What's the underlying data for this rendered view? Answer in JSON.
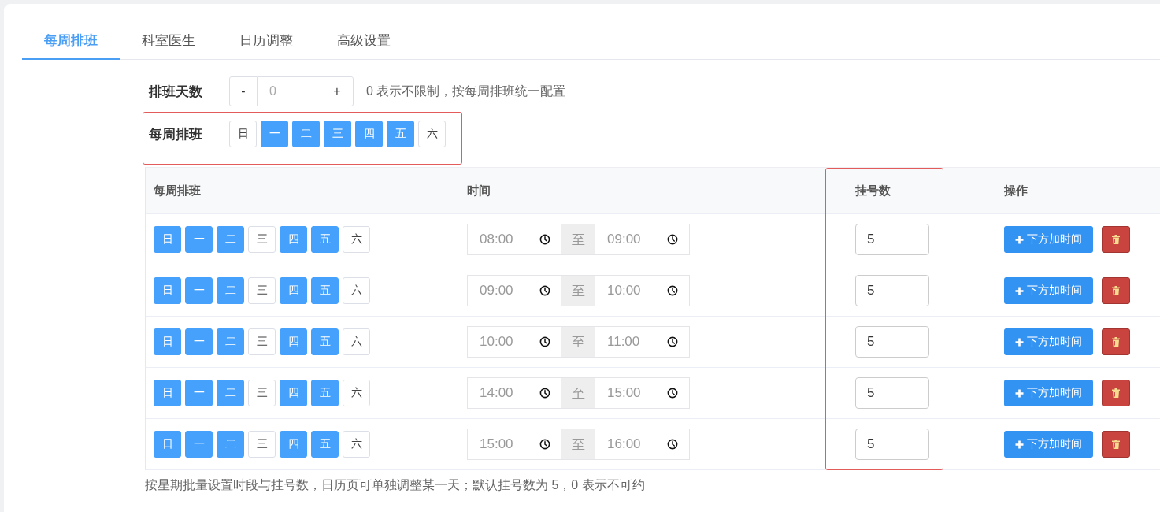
{
  "tabs": [
    {
      "label": "每周排班",
      "selected": true
    },
    {
      "label": "科室医生",
      "selected": false
    },
    {
      "label": "日历调整",
      "selected": false
    },
    {
      "label": "高级设置",
      "selected": false
    }
  ],
  "schedule_days": {
    "label": "排班天数",
    "decrement": "-",
    "input": {
      "placeholder": "0"
    },
    "increment": "+",
    "hint": "0 表示不限制，按每周排班统一配置"
  },
  "weekly_schedule": {
    "label": "每周排班",
    "highlighted": true,
    "days": [
      {
        "label": "日",
        "selected": false
      },
      {
        "label": "一",
        "selected": true
      },
      {
        "label": "二",
        "selected": true
      },
      {
        "label": "三",
        "selected": true
      },
      {
        "label": "四",
        "selected": true
      },
      {
        "label": "五",
        "selected": true
      },
      {
        "label": "六",
        "selected": false
      }
    ]
  },
  "table": {
    "columns": [
      {
        "label": "每周排班",
        "highlighted": false
      },
      {
        "label": "时间",
        "highlighted": false
      },
      {
        "label": "挂号数",
        "highlighted": true
      },
      {
        "label": "操作",
        "highlighted": false
      }
    ],
    "rows": [
      {
        "days": [
          {
            "label": "日",
            "selected": true
          },
          {
            "label": "一",
            "selected": true
          },
          {
            "label": "二",
            "selected": true
          },
          {
            "label": "三",
            "selected": false
          },
          {
            "label": "四",
            "selected": true
          },
          {
            "label": "五",
            "selected": true
          },
          {
            "label": "六",
            "selected": false
          }
        ],
        "start_time": "08:00",
        "separator": "至",
        "end_time": "09:00",
        "quota": "5",
        "add_button": "下方加时间"
      },
      {
        "days": [
          {
            "label": "日",
            "selected": true
          },
          {
            "label": "一",
            "selected": true
          },
          {
            "label": "二",
            "selected": true
          },
          {
            "label": "三",
            "selected": false
          },
          {
            "label": "四",
            "selected": true
          },
          {
            "label": "五",
            "selected": true
          },
          {
            "label": "六",
            "selected": false
          }
        ],
        "start_time": "09:00",
        "separator": "至",
        "end_time": "10:00",
        "quota": "5",
        "add_button": "下方加时间"
      },
      {
        "days": [
          {
            "label": "日",
            "selected": true
          },
          {
            "label": "一",
            "selected": true
          },
          {
            "label": "二",
            "selected": true
          },
          {
            "label": "三",
            "selected": false
          },
          {
            "label": "四",
            "selected": true
          },
          {
            "label": "五",
            "selected": true
          },
          {
            "label": "六",
            "selected": false
          }
        ],
        "start_time": "10:00",
        "separator": "至",
        "end_time": "11:00",
        "quota": "5",
        "add_button": "下方加时间"
      },
      {
        "days": [
          {
            "label": "日",
            "selected": true
          },
          {
            "label": "一",
            "selected": true
          },
          {
            "label": "二",
            "selected": true
          },
          {
            "label": "三",
            "selected": false
          },
          {
            "label": "四",
            "selected": true
          },
          {
            "label": "五",
            "selected": true
          },
          {
            "label": "六",
            "selected": false
          }
        ],
        "start_time": "14:00",
        "separator": "至",
        "end_time": "15:00",
        "quota": "5",
        "add_button": "下方加时间"
      },
      {
        "days": [
          {
            "label": "日",
            "selected": true
          },
          {
            "label": "一",
            "selected": true
          },
          {
            "label": "二",
            "selected": true
          },
          {
            "label": "三",
            "selected": false
          },
          {
            "label": "四",
            "selected": true
          },
          {
            "label": "五",
            "selected": true
          },
          {
            "label": "六",
            "selected": false
          }
        ],
        "start_time": "15:00",
        "separator": "至",
        "end_time": "16:00",
        "quota": "5",
        "add_button": "下方加时间"
      }
    ]
  },
  "footer_note": "按星期批量设置时段与挂号数，日历页可单独调整某一天；默认挂号数为 5，0 表示不可约"
}
